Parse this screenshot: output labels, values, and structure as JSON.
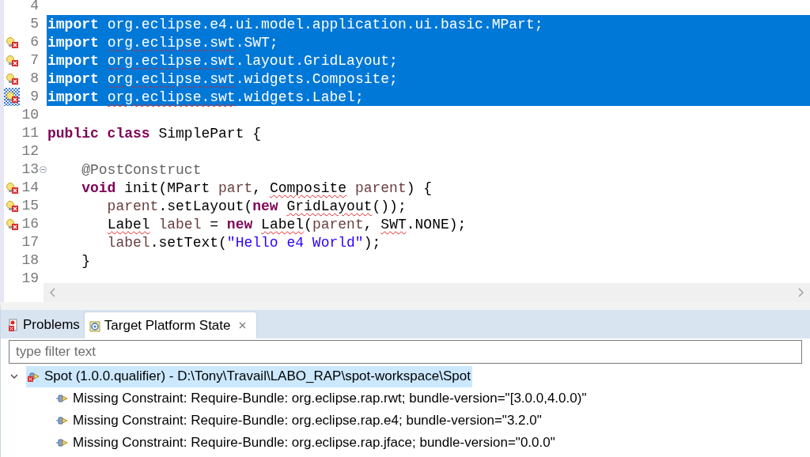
{
  "editor": {
    "lines": [
      {
        "n": "4",
        "selected": false,
        "error": false,
        "range": false
      },
      {
        "n": "5",
        "selected": true,
        "error": false,
        "range": false,
        "segments": [
          {
            "kind": "kw",
            "text": "import "
          },
          {
            "kind": "plain",
            "text": "org.eclipse.e4.ui.model.application.ui.basic.MPart;"
          }
        ]
      },
      {
        "n": "6",
        "selected": true,
        "error": true,
        "range": false,
        "segments": [
          {
            "kind": "kw",
            "text": "import "
          },
          {
            "kind": "plain",
            "text": "org.eclipse.swt",
            "squiggly": true
          },
          {
            "kind": "plain",
            "text": ".SWT;"
          }
        ]
      },
      {
        "n": "7",
        "selected": true,
        "error": true,
        "range": false,
        "segments": [
          {
            "kind": "kw",
            "text": "import "
          },
          {
            "kind": "plain",
            "text": "org.eclipse.swt",
            "squiggly": true
          },
          {
            "kind": "plain",
            "text": ".layout.GridLayout;"
          }
        ]
      },
      {
        "n": "8",
        "selected": true,
        "error": true,
        "range": false,
        "segments": [
          {
            "kind": "kw",
            "text": "import "
          },
          {
            "kind": "plain",
            "text": "org.eclipse.swt",
            "squiggly": true
          },
          {
            "kind": "plain",
            "text": ".widgets.Composite;"
          }
        ]
      },
      {
        "n": "9",
        "selected": true,
        "error": true,
        "range": true,
        "segments": [
          {
            "kind": "kw",
            "text": "import "
          },
          {
            "kind": "plain",
            "text": "org.eclipse.swt",
            "squiggly": true
          },
          {
            "kind": "plain",
            "text": ".widgets.Label;"
          }
        ]
      },
      {
        "n": "10",
        "selected": false,
        "error": false,
        "range": false
      },
      {
        "n": "11",
        "selected": false,
        "error": false,
        "range": false,
        "segments": [
          {
            "kind": "kw",
            "text": "public class"
          },
          {
            "kind": "plain",
            "text": " SimplePart {"
          }
        ]
      },
      {
        "n": "12",
        "selected": false,
        "error": false,
        "range": false
      },
      {
        "n": "13",
        "selected": false,
        "error": false,
        "range": false,
        "expanded": true,
        "segments": [
          {
            "kind": "ann",
            "text": "    @PostConstruct"
          }
        ]
      },
      {
        "n": "14",
        "selected": false,
        "error": true,
        "range": false,
        "segments": [
          {
            "kind": "kw",
            "text": "    void"
          },
          {
            "kind": "plain",
            "text": " init(MPart "
          },
          {
            "kind": "var",
            "text": "part"
          },
          {
            "kind": "plain",
            "text": ", "
          },
          {
            "kind": "plain",
            "text": "Composite",
            "squiggly": true
          },
          {
            "kind": "var",
            "text": " parent"
          },
          {
            "kind": "plain",
            "text": ") {"
          }
        ]
      },
      {
        "n": "15",
        "selected": false,
        "error": true,
        "range": false,
        "segments": [
          {
            "kind": "var",
            "text": "       parent"
          },
          {
            "kind": "plain",
            "text": ".setLayout("
          },
          {
            "kind": "kw",
            "text": "new "
          },
          {
            "kind": "plain",
            "text": "GridLayout",
            "squiggly": true
          },
          {
            "kind": "plain",
            "text": "());"
          }
        ]
      },
      {
        "n": "16",
        "selected": false,
        "error": true,
        "range": false,
        "segments": [
          {
            "kind": "plain",
            "text": "       Label",
            "squiggly": true
          },
          {
            "kind": "var",
            "text": " label"
          },
          {
            "kind": "plain",
            "text": " = "
          },
          {
            "kind": "kw",
            "text": "new "
          },
          {
            "kind": "plain",
            "text": "Label",
            "squiggly": true
          },
          {
            "kind": "plain",
            "text": "("
          },
          {
            "kind": "var",
            "text": "parent"
          },
          {
            "kind": "plain",
            "text": ", "
          },
          {
            "kind": "plain",
            "text": "SWT",
            "squiggly": true
          },
          {
            "kind": "plain",
            "text": ".NONE);"
          }
        ]
      },
      {
        "n": "17",
        "selected": false,
        "error": false,
        "range": false,
        "segments": [
          {
            "kind": "var",
            "text": "       label"
          },
          {
            "kind": "plain",
            "text": ".setText("
          },
          {
            "kind": "str",
            "text": "\"Hello e4 World\""
          },
          {
            "kind": "plain",
            "text": ");"
          }
        ]
      },
      {
        "n": "18",
        "selected": false,
        "error": false,
        "range": false,
        "segments": [
          {
            "kind": "plain",
            "text": "    }"
          }
        ]
      },
      {
        "n": "19",
        "selected": false,
        "error": false,
        "range": false
      }
    ]
  },
  "tabs": [
    {
      "label": "Problems",
      "selected": false,
      "closable": false
    },
    {
      "label": "Target Platform State",
      "selected": true,
      "closable": true
    }
  ],
  "filter": {
    "placeholder": "type filter text"
  },
  "tree": [
    {
      "label": "Spot (1.0.0.qualifier) - D:\\Tony\\Travail\\LABO_RAP\\spot-workspace\\Spot",
      "error": true,
      "expanded": true,
      "selected": true,
      "children": [
        {
          "label": "Missing Constraint: Require-Bundle: org.eclipse.rap.rwt; bundle-version=\"[3.0.0,4.0.0)\"",
          "error": false,
          "selected": false
        },
        {
          "label": "Missing Constraint: Require-Bundle: org.eclipse.rap.e4; bundle-version=\"3.2.0\"",
          "error": false,
          "selected": false
        },
        {
          "label": "Missing Constraint: Require-Bundle: org.eclipse.rap.jface; bundle-version=\"0.0.0\"",
          "error": false,
          "selected": false
        }
      ]
    }
  ]
}
